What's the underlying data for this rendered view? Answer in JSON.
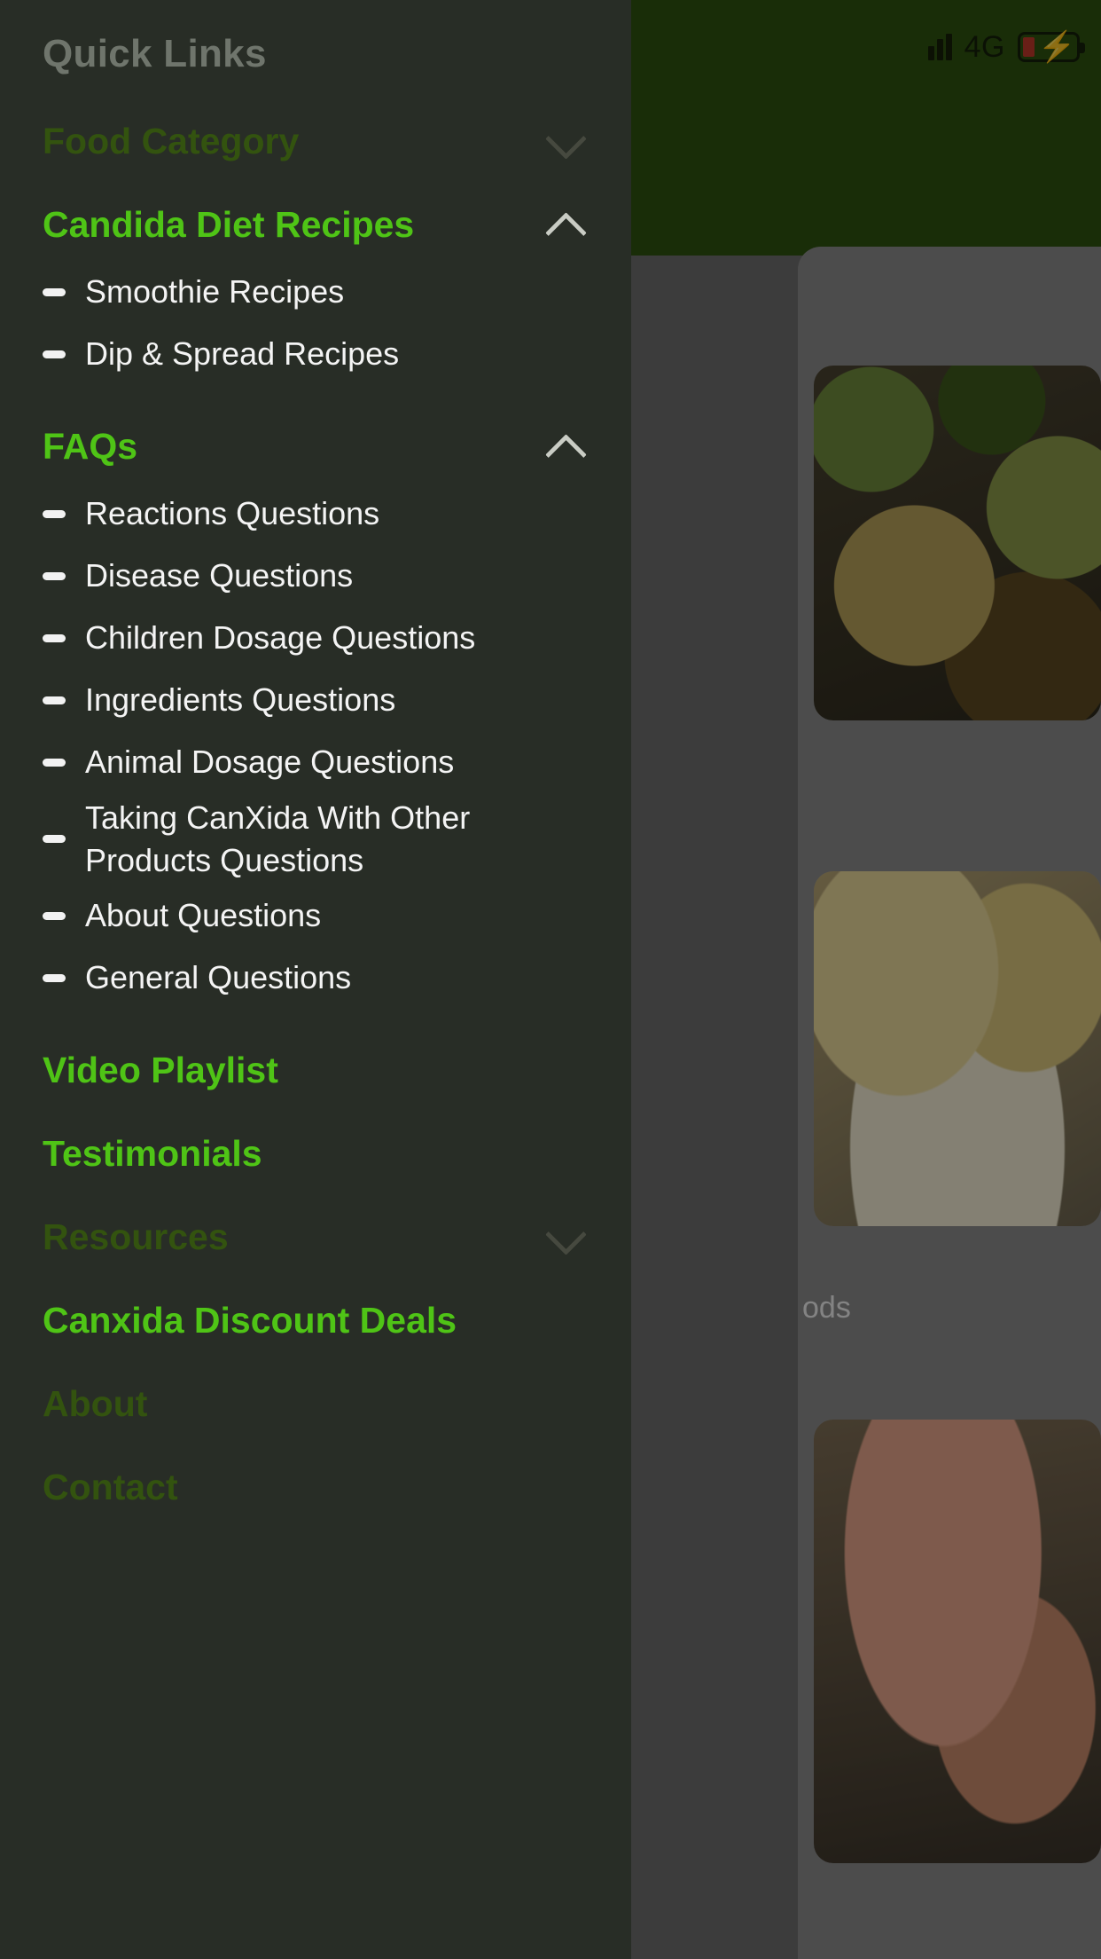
{
  "status_bar": {
    "network": "4G",
    "signal_icon": "signal-bars-icon",
    "battery_icon": "battery-charging-icon",
    "battery_low_color": "#c0392b"
  },
  "background": {
    "header_color": "#2f5210",
    "caption_1": "ods"
  },
  "drawer": {
    "title": "Quick Links",
    "accent_bright": "#4fc416",
    "accent_dim": "#33530f",
    "background": "#282d26",
    "items": [
      {
        "label": "Food Category",
        "state": "collapsed",
        "tone": "dim",
        "chevron": "chevron-down-icon",
        "children": []
      },
      {
        "label": "Candida Diet Recipes",
        "state": "expanded",
        "tone": "bright",
        "chevron": "chevron-up-icon",
        "children": [
          "Smoothie Recipes",
          "Dip & Spread Recipes"
        ]
      },
      {
        "label": "FAQs",
        "state": "expanded",
        "tone": "bright",
        "chevron": "chevron-up-icon",
        "children": [
          "Reactions Questions",
          "Disease Questions",
          "Children Dosage Questions",
          "Ingredients Questions",
          "Animal Dosage Questions",
          "Taking CanXida With Other Products Questions",
          "About Questions",
          "General Questions"
        ]
      },
      {
        "label": "Video Playlist",
        "state": "link",
        "tone": "bright",
        "chevron": null,
        "children": []
      },
      {
        "label": "Testimonials",
        "state": "link",
        "tone": "bright",
        "chevron": null,
        "children": []
      },
      {
        "label": "Resources",
        "state": "collapsed",
        "tone": "dim",
        "chevron": "chevron-down-icon",
        "children": []
      },
      {
        "label": "Canxida Discount Deals",
        "state": "link",
        "tone": "bright",
        "chevron": null,
        "children": []
      },
      {
        "label": "About",
        "state": "link",
        "tone": "dim",
        "chevron": null,
        "children": []
      },
      {
        "label": "Contact",
        "state": "link",
        "tone": "dim",
        "chevron": null,
        "children": []
      }
    ]
  }
}
